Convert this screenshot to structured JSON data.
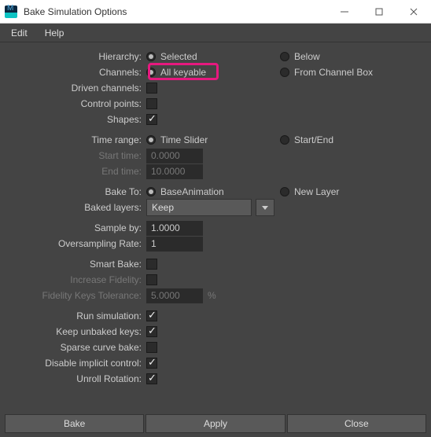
{
  "window": {
    "title": "Bake Simulation Options"
  },
  "menu": {
    "edit": "Edit",
    "help": "Help"
  },
  "labels": {
    "hierarchy": "Hierarchy:",
    "channels": "Channels:",
    "driven": "Driven channels:",
    "controlpts": "Control points:",
    "shapes": "Shapes:",
    "timerange": "Time range:",
    "starttime": "Start time:",
    "endtime": "End time:",
    "baketo": "Bake To:",
    "bakedlayers": "Baked layers:",
    "sampleby": "Sample by:",
    "oversampling": "Oversampling Rate:",
    "smartbake": "Smart Bake:",
    "incfidelity": "Increase Fidelity:",
    "fidelitytol": "Fidelity Keys Tolerance:",
    "runsim": "Run simulation:",
    "keepunbaked": "Keep unbaked keys:",
    "sparse": "Sparse curve bake:",
    "disableimpl": "Disable implicit control:",
    "unroll": "Unroll Rotation:"
  },
  "radios": {
    "hierarchy_selected": "Selected",
    "hierarchy_below": "Below",
    "channels_allkeyable": "All keyable",
    "channels_frombox": "From Channel Box",
    "timerange_slider": "Time Slider",
    "timerange_startend": "Start/End",
    "baketo_base": "BaseAnimation",
    "baketo_new": "New Layer"
  },
  "values": {
    "starttime": "0.0000",
    "endtime": "10.0000",
    "bakedlayers": "Keep",
    "sampleby": "1.0000",
    "oversampling": "1",
    "fidelitytol": "5.0000",
    "pct": "%"
  },
  "buttons": {
    "bake": "Bake",
    "apply": "Apply",
    "close": "Close"
  }
}
